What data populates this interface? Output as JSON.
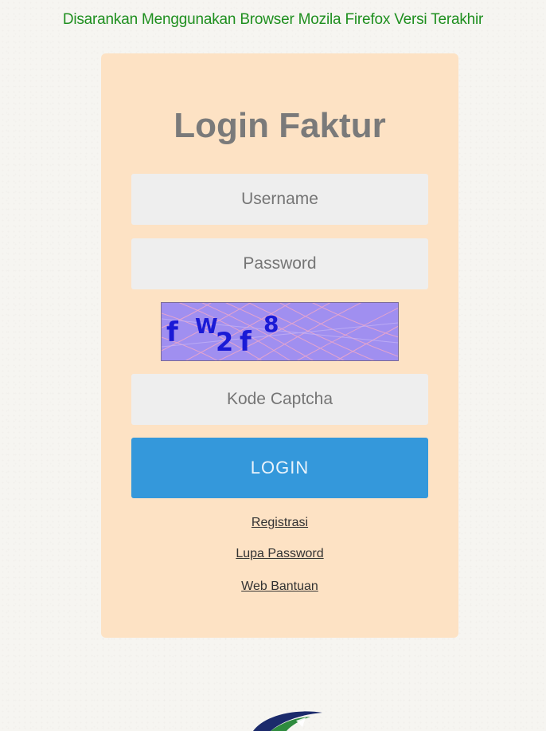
{
  "notice": "Disarankan Menggunakan Browser Mozila Firefox Versi Terakhir",
  "login_form": {
    "title": "Login Faktur",
    "username_placeholder": "Username",
    "password_placeholder": "Password",
    "captcha_text": [
      "f",
      "W",
      "2",
      "f",
      "8"
    ],
    "captcha_placeholder": "Kode Captcha",
    "login_label": "LOGIN"
  },
  "links": {
    "registrasi": "Registrasi",
    "lupa_password": "Lupa Password",
    "web_bantuan": "Web Bantuan"
  },
  "colors": {
    "notice_text": "#1f8f1f",
    "card_background": "#fde2c4",
    "login_button": "#3498db",
    "captcha_background": "#a08ff0",
    "captcha_text": "#1a1ad6"
  },
  "icons": {
    "footer_logo": "logo-swoosh"
  }
}
